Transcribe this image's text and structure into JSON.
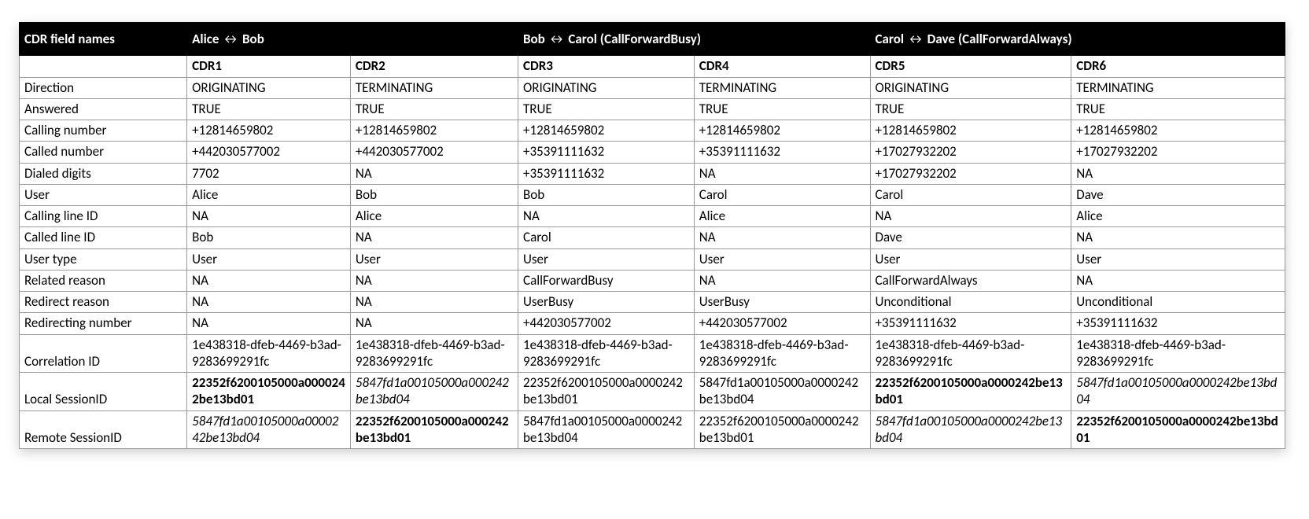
{
  "header": {
    "field_col": "CDR field names",
    "groups": [
      {
        "label_pre": "Alice ",
        "arrow": "↔",
        "label_post": " Bob"
      },
      {
        "label_pre": "Bob ",
        "arrow": "↔",
        "label_post": " Carol (CallForwardBusy)"
      },
      {
        "label_pre": "Carol ",
        "arrow": "↔",
        "label_post": " Dave (CallForwardAlways)"
      }
    ],
    "cdr": [
      "CDR1",
      "CDR2",
      "CDR3",
      "CDR4",
      "CDR5",
      "CDR6"
    ]
  },
  "rows": [
    {
      "name": "Direction",
      "cells": [
        {
          "t": "ORIGINATING"
        },
        {
          "t": "TERMINATING"
        },
        {
          "t": "ORIGINATING"
        },
        {
          "t": "TERMINATING"
        },
        {
          "t": "ORIGINATING"
        },
        {
          "t": "TERMINATING"
        }
      ]
    },
    {
      "name": "Answered",
      "cells": [
        {
          "t": "TRUE"
        },
        {
          "t": "TRUE"
        },
        {
          "t": "TRUE"
        },
        {
          "t": "TRUE"
        },
        {
          "t": "TRUE"
        },
        {
          "t": "TRUE"
        }
      ]
    },
    {
      "name": "Calling number",
      "cells": [
        {
          "t": "+12814659802"
        },
        {
          "t": "+12814659802"
        },
        {
          "t": "+12814659802"
        },
        {
          "t": "+12814659802"
        },
        {
          "t": "+12814659802"
        },
        {
          "t": "+12814659802"
        }
      ]
    },
    {
      "name": "Called number",
      "cells": [
        {
          "t": "+442030577002"
        },
        {
          "t": "+442030577002"
        },
        {
          "t": "+35391111632"
        },
        {
          "t": "+35391111632"
        },
        {
          "t": "+17027932202"
        },
        {
          "t": "+17027932202"
        }
      ]
    },
    {
      "name": "Dialed digits",
      "cells": [
        {
          "t": "7702"
        },
        {
          "t": "NA"
        },
        {
          "t": "+35391111632"
        },
        {
          "t": "NA"
        },
        {
          "t": "+17027932202"
        },
        {
          "t": "NA"
        }
      ]
    },
    {
      "name": "User",
      "cells": [
        {
          "t": "Alice"
        },
        {
          "t": "Bob"
        },
        {
          "t": "Bob"
        },
        {
          "t": "Carol"
        },
        {
          "t": "Carol"
        },
        {
          "t": "Dave"
        }
      ]
    },
    {
      "name": "Calling line ID",
      "cells": [
        {
          "t": "NA"
        },
        {
          "t": "Alice"
        },
        {
          "t": "NA"
        },
        {
          "t": "Alice"
        },
        {
          "t": "NA"
        },
        {
          "t": "Alice"
        }
      ]
    },
    {
      "name": "Called line ID",
      "cells": [
        {
          "t": "Bob"
        },
        {
          "t": "NA"
        },
        {
          "t": "Carol"
        },
        {
          "t": "NA"
        },
        {
          "t": "Dave"
        },
        {
          "t": "NA"
        }
      ]
    },
    {
      "name": "User type",
      "cells": [
        {
          "t": "User"
        },
        {
          "t": "User"
        },
        {
          "t": "User"
        },
        {
          "t": "User"
        },
        {
          "t": "User"
        },
        {
          "t": "User"
        }
      ]
    },
    {
      "name": "Related reason",
      "cells": [
        {
          "t": "NA"
        },
        {
          "t": "NA"
        },
        {
          "t": "CallForwardBusy"
        },
        {
          "t": "NA"
        },
        {
          "t": "CallForwardAlways"
        },
        {
          "t": "NA"
        }
      ]
    },
    {
      "name": "Redirect reason",
      "cells": [
        {
          "t": "NA"
        },
        {
          "t": "NA"
        },
        {
          "t": "UserBusy"
        },
        {
          "t": "UserBusy"
        },
        {
          "t": "Unconditional"
        },
        {
          "t": "Unconditional"
        }
      ]
    },
    {
      "name": "Redirecting number",
      "cells": [
        {
          "t": "NA"
        },
        {
          "t": "NA"
        },
        {
          "t": "+442030577002"
        },
        {
          "t": "+442030577002"
        },
        {
          "t": "+35391111632"
        },
        {
          "t": "+35391111632"
        }
      ]
    },
    {
      "name": "Correlation ID",
      "cells": [
        {
          "t": "1e438318-dfeb-4469-b3ad-9283699291fc"
        },
        {
          "t": "1e438318-dfeb-4469-b3ad-9283699291fc"
        },
        {
          "t": "1e438318-dfeb-4469-b3ad-9283699291fc"
        },
        {
          "t": "1e438318-dfeb-4469-b3ad-9283699291fc"
        },
        {
          "t": "1e438318-dfeb-4469-b3ad-9283699291fc"
        },
        {
          "t": "1e438318-dfeb-4469-b3ad-9283699291fc"
        }
      ]
    },
    {
      "name": "Local SessionID",
      "cells": [
        {
          "t": "22352f6200105000a0000242be13bd01",
          "s": "bold"
        },
        {
          "t": "5847fd1a00105000a000242be13bd04",
          "s": "ital"
        },
        {
          "t": "22352f6200105000a0000242be13bd01"
        },
        {
          "t": "5847fd1a00105000a0000242be13bd04"
        },
        {
          "t": "22352f6200105000a0000242be13bd01",
          "s": "bold"
        },
        {
          "t": "5847fd1a00105000a0000242be13bd04",
          "s": "ital"
        }
      ]
    },
    {
      "name": "Remote SessionID",
      "cells": [
        {
          "t": "5847fd1a00105000a0000242be13bd04",
          "s": "ital"
        },
        {
          "t": "22352f6200105000a000242be13bd01",
          "s": "bold"
        },
        {
          "t": "5847fd1a00105000a0000242be13bd04"
        },
        {
          "t": "22352f6200105000a0000242be13bd01"
        },
        {
          "t": "5847fd1a00105000a0000242be13bd04",
          "s": "ital"
        },
        {
          "t": "22352f6200105000a0000242be13bd01",
          "s": "bold"
        }
      ]
    }
  ]
}
